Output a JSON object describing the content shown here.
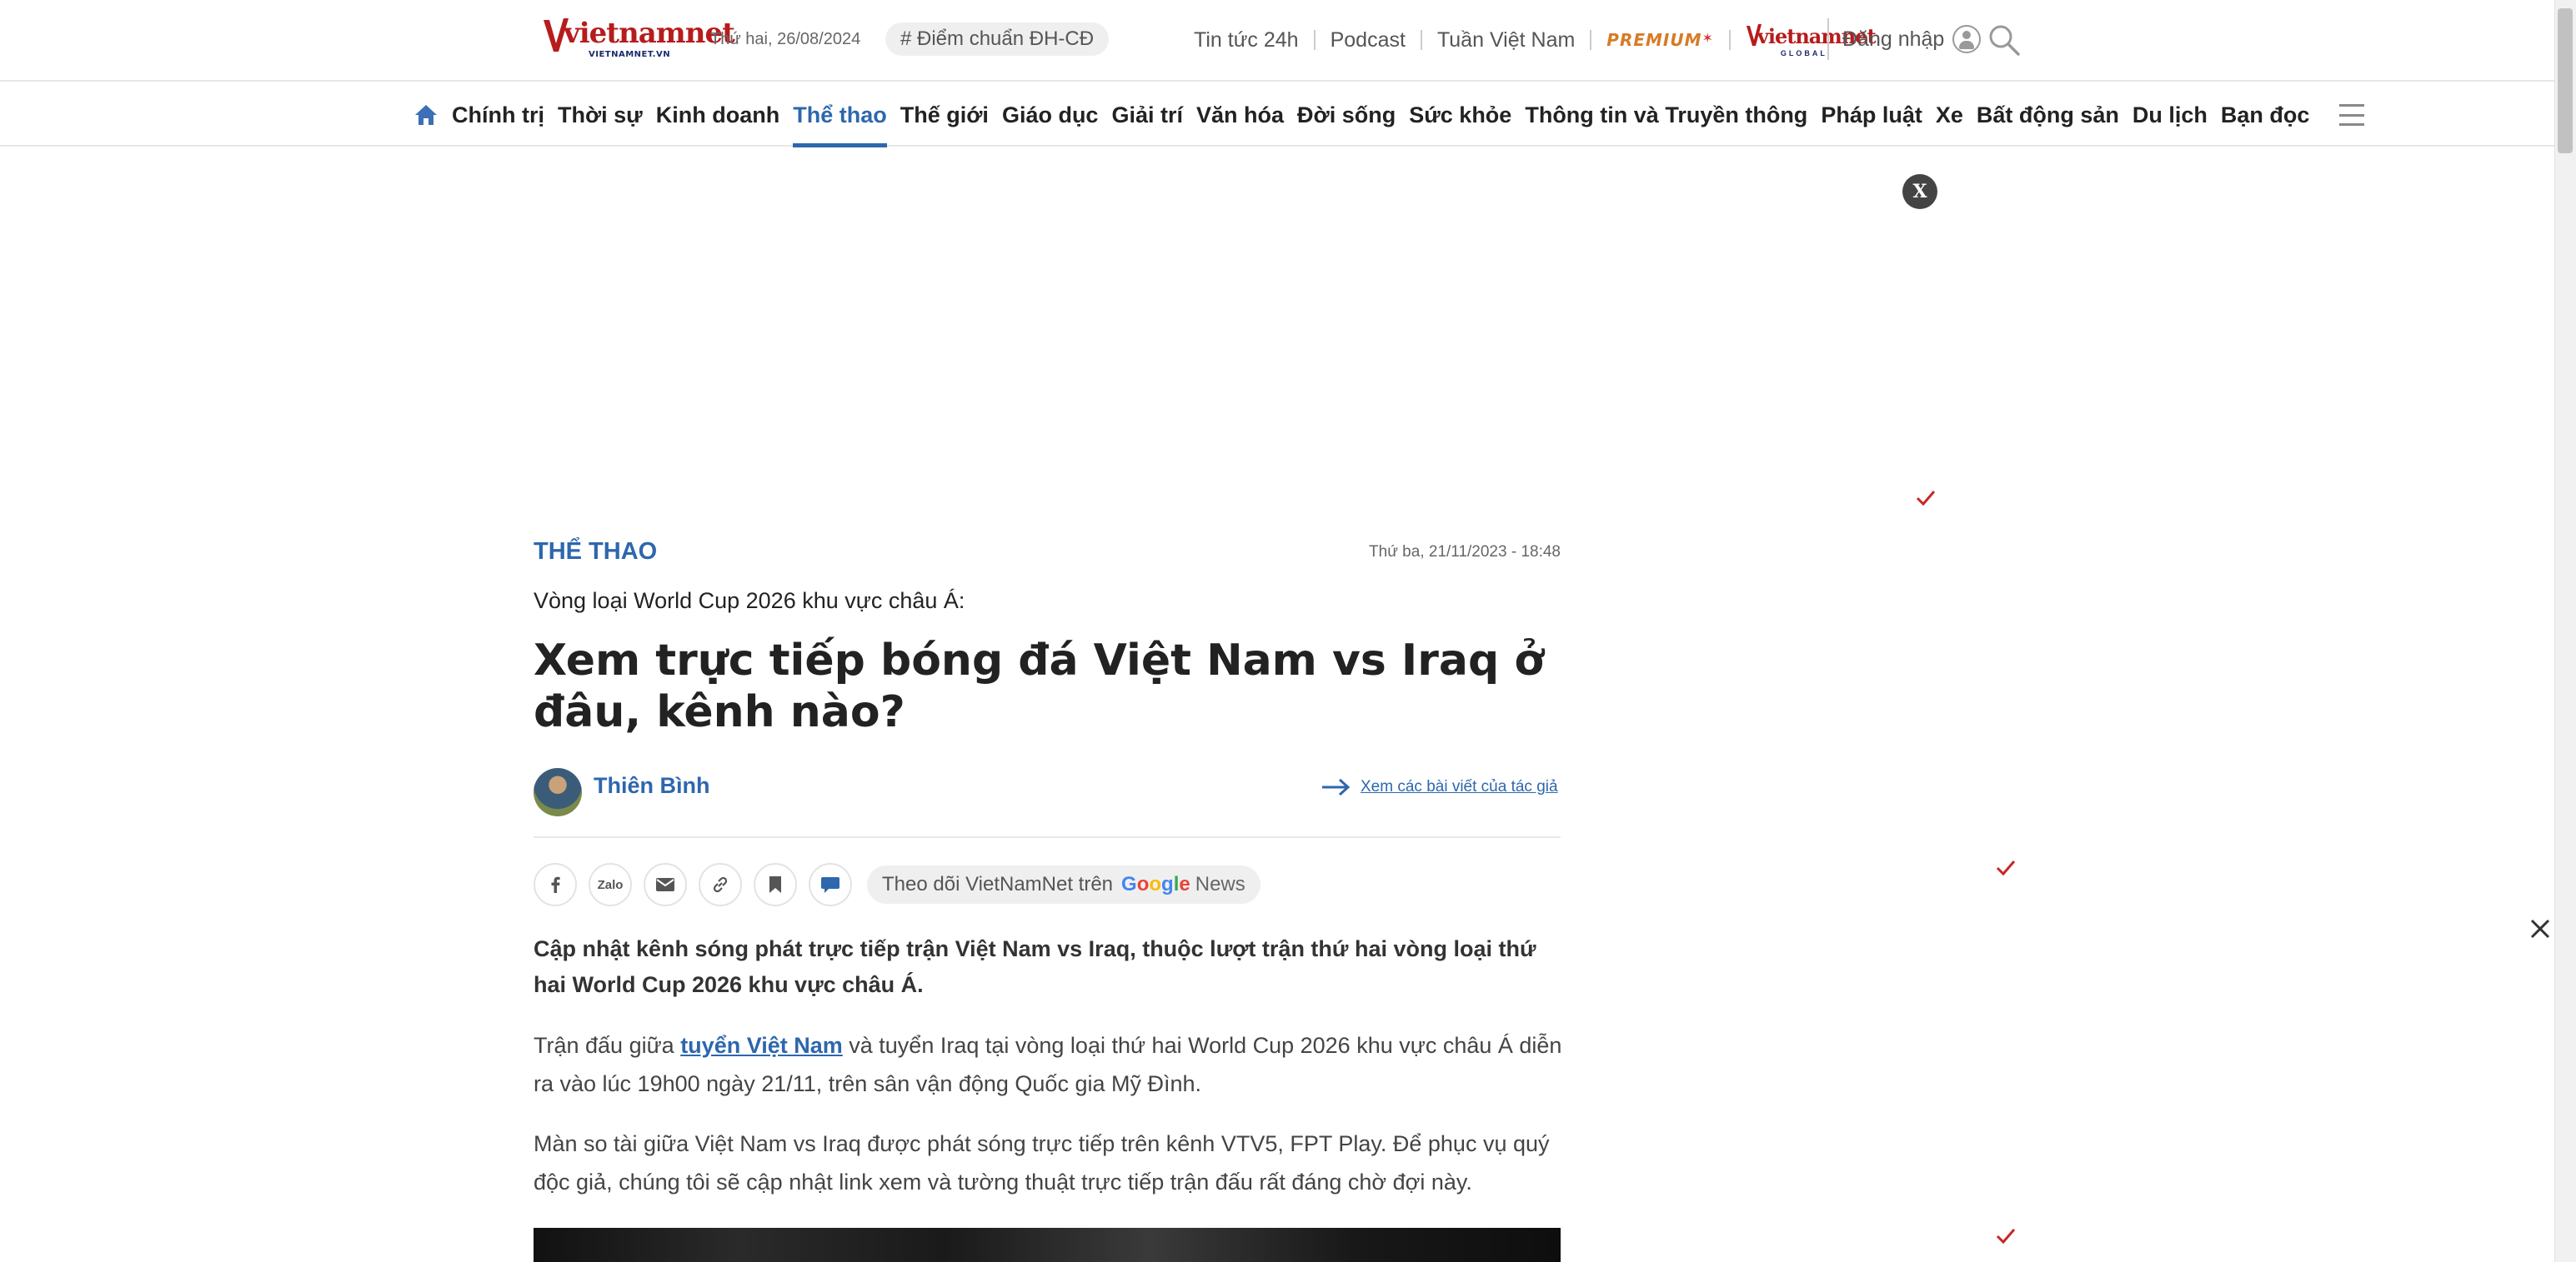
{
  "header": {
    "logo_word": "vietnamnet",
    "logo_sub": "VIETNAMNET.VN",
    "date": "Thứ hai, 26/08/2024",
    "hashtag": "# Điểm chuẩn ĐH-CĐ",
    "links": [
      "Tin tức 24h",
      "Podcast",
      "Tuần Việt Nam"
    ],
    "premium": "PREMIUM",
    "global_logo_word": "vietnamnet",
    "global_logo_sub": "GLOBAL",
    "login": "Đăng nhập",
    "icons": {
      "user": "user-icon",
      "search": "search-icon"
    }
  },
  "nav": {
    "items": [
      "Chính trị",
      "Thời sự",
      "Kinh doanh",
      "Thể thao",
      "Thế giới",
      "Giáo dục",
      "Giải trí",
      "Văn hóa",
      "Đời sống",
      "Sức khỏe",
      "Thông tin và Truyền thông",
      "Pháp luật",
      "Xe",
      "Bất động sản",
      "Du lịch",
      "Bạn đọc"
    ],
    "active": "Thể thao",
    "icons": {
      "home": "home-icon",
      "menu": "menu-icon"
    }
  },
  "ad": {
    "close_label": "X"
  },
  "article": {
    "category": "THỂ THAO",
    "published": "Thứ ba, 21/11/2023 - 18:48",
    "kicker": "Vòng loại World Cup 2026 khu vực châu Á:",
    "title": "Xem trực tiếp bóng đá Việt Nam vs Iraq ở đâu, kênh nào?",
    "author": "Thiên Bình",
    "author_link": "Xem các bài viết của tác giả",
    "share": {
      "zalo": "Zalo",
      "follow_text": "Theo dõi VietNamNet trên",
      "google": "Google",
      "news": "News"
    },
    "lead": "Cập nhật kênh sóng phát trực tiếp trận Việt Nam vs Iraq, thuộc lượt trận thứ hai vòng loại thứ hai World Cup 2026 khu vực châu Á.",
    "p1_before": "Trận đấu giữa ",
    "p1_link": "tuyển Việt Nam",
    "p1_after": " và tuyển Iraq tại vòng loại thứ hai World Cup 2026 khu vực châu Á diễn ra vào lúc 19h00 ngày 21/11, trên sân vận động Quốc gia Mỹ Đình.",
    "p2": "Màn so tài giữa Việt Nam vs Iraq được phát sóng trực tiếp trên kênh VTV5, FPT Play. Để phục vụ quý độc giả, chúng tôi sẽ cập nhật link xem và tường thuật trực tiếp trận đấu rất đáng chờ đợi này."
  },
  "colors": {
    "brand_blue": "#2d67ad",
    "brand_red": "#b71c1c",
    "premium": "#d77b26"
  }
}
